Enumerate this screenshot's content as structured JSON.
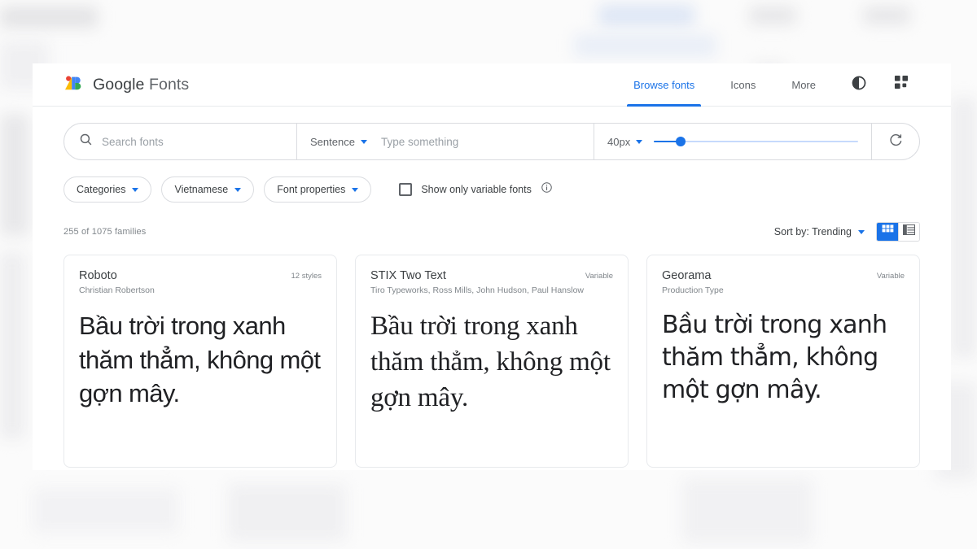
{
  "header": {
    "brand_bold": "Google",
    "brand_light": "Fonts",
    "logo_icon": "google-fonts-logo",
    "nav": [
      {
        "label": "Browse fonts",
        "active": true
      },
      {
        "label": "Icons",
        "active": false
      },
      {
        "label": "More",
        "active": false
      }
    ],
    "dark_mode_icon": "contrast-icon",
    "apps_icon": "google-apps-grid-icon"
  },
  "search": {
    "search_icon": "search-icon",
    "search_placeholder": "Search fonts",
    "search_value": "",
    "preview_type": "Sentence",
    "preview_placeholder": "Type something",
    "preview_value": "",
    "font_size": "40px",
    "slider_percent": 13,
    "reset_icon": "refresh-icon"
  },
  "filters": {
    "chips": [
      {
        "label": "Categories",
        "name": "categories"
      },
      {
        "label": "Vietnamese",
        "name": "language"
      },
      {
        "label": "Font properties",
        "name": "font-properties"
      }
    ],
    "variable_only_label": "Show only variable fonts",
    "variable_only_checked": false,
    "info_icon": "info-icon"
  },
  "results": {
    "count_text": "255 of 1075 families",
    "sort_label": "Sort by: Trending",
    "grid_view_icon": "grid-view-icon",
    "list_view_icon": "list-view-icon",
    "active_view": "grid"
  },
  "cards": [
    {
      "name": "Roboto",
      "author": "Christian Robertson",
      "tag": "12 styles",
      "sample": "Bầu trời trong xanh thăm thẳm, không một gợn mây.",
      "style": "sans"
    },
    {
      "name": "STIX Two Text",
      "author": "Tiro Typeworks, Ross Mills, John Hudson, Paul Hanslow",
      "tag": "Variable",
      "sample": "Bầu trời trong xanh thăm thẳm, không một gợn mây.",
      "style": "serif"
    },
    {
      "name": "Georama",
      "author": "Production Type",
      "tag": "Variable",
      "sample": "Bầu trời trong xanh thăm thẳm, không một gợn mây.",
      "style": "geo"
    }
  ],
  "colors": {
    "accent_blue": "#1a73e8",
    "text_primary": "#3c4043",
    "text_secondary": "#5f6368",
    "text_muted": "#80868b",
    "border": "#dadce0",
    "logo_red": "#ea4335",
    "logo_yellow": "#fbbc04",
    "logo_blue": "#4285f4",
    "logo_green": "#34a853"
  }
}
